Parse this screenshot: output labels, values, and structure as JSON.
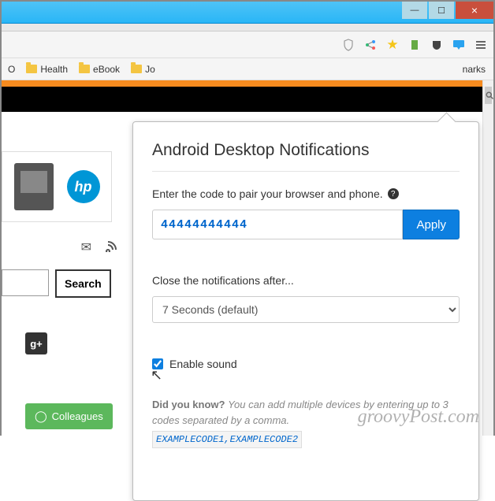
{
  "window": {
    "close": "×",
    "min": "—",
    "max": "☐"
  },
  "toolbar_icons": {
    "shield": "shield",
    "share": "share",
    "star": "star",
    "ext1": "ext",
    "pocket": "pocket",
    "notif": "notif",
    "menu": "menu"
  },
  "bookmarks": {
    "first_label": "O",
    "items": [
      "Health",
      "eBook",
      "Jo"
    ],
    "right": "narks"
  },
  "page": {
    "hp_logo": "hp",
    "search_btn": "Search",
    "gplus": "g+",
    "colleagues": "Colleagues"
  },
  "popup": {
    "title": "Android Desktop Notifications",
    "pair_label": "Enter the code to pair your browser and phone.",
    "code_value": "44444444444",
    "apply": "Apply",
    "close_label": "Close the notifications after...",
    "duration": "7 Seconds (default)",
    "enable_sound": "Enable sound",
    "sound_checked": true,
    "dyk_title": "Did you know?",
    "dyk_body": "You can add multiple devices by entering up to 3 codes separated by a comma.",
    "dyk_code": "EXAMPLECODE1,EXAMPLECODE2"
  },
  "watermark": "groovyPost.com"
}
